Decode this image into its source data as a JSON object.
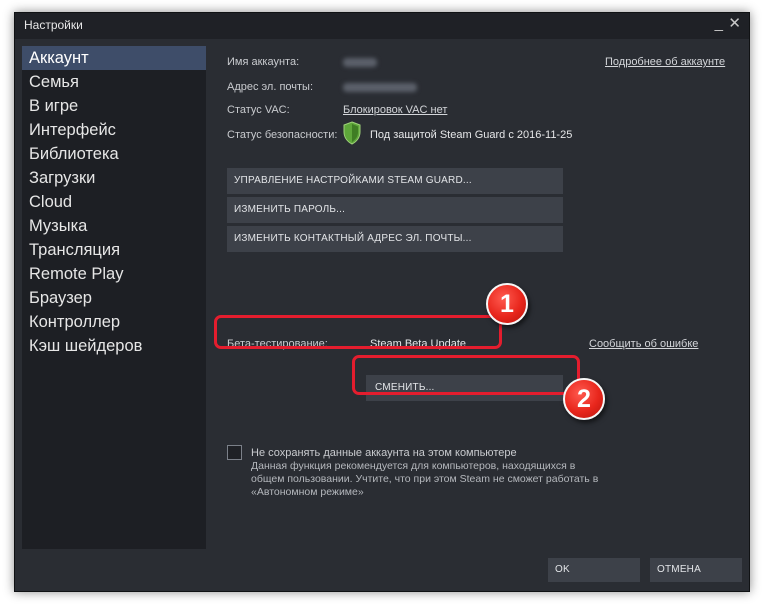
{
  "window": {
    "title": "Настройки",
    "minimize_glyph": "_",
    "close_glyph": "✕"
  },
  "sidebar": {
    "items": [
      {
        "label": "Аккаунт",
        "active": true
      },
      {
        "label": "Семья"
      },
      {
        "label": "В игре"
      },
      {
        "label": "Интерфейс"
      },
      {
        "label": "Библиотека"
      },
      {
        "label": "Загрузки"
      },
      {
        "label": "Cloud"
      },
      {
        "label": "Музыка"
      },
      {
        "label": "Трансляция"
      },
      {
        "label": "Remote Play"
      },
      {
        "label": "Браузер"
      },
      {
        "label": "Контроллер"
      },
      {
        "label": "Кэш шейдеров"
      }
    ]
  },
  "account": {
    "name_label": "Имя аккаунта:",
    "email_label": "Адрес эл. почты:",
    "vac_label": "Статус VAC:",
    "vac_value": "Блокировок VAC нет",
    "security_label": "Статус безопасности:",
    "security_value": "Под защитой Steam Guard с 2016-11-25",
    "details_link": "Подробнее об аккаунте",
    "shield_color": "#5ea63a"
  },
  "buttons": {
    "steam_guard": "УПРАВЛЕНИЕ НАСТРОЙКАМИ STEAM GUARD...",
    "change_password": "ИЗМЕНИТЬ ПАРОЛЬ...",
    "change_email": "ИЗМЕНИТЬ КОНТАКТНЫЙ АДРЕС ЭЛ. ПОЧТЫ...",
    "change_beta": "СМЕНИТЬ..."
  },
  "beta": {
    "label": "Бета-тестирование:",
    "value": "Steam Beta Update",
    "report_link": "Сообщить об ошибке"
  },
  "remember": {
    "checkbox_label": "Не сохранять данные аккаунта на этом компьютере",
    "checked": false,
    "note": "Данная функция рекомендуется для компьютеров, находящихся в общем пользовании. Учтите, что при этом Steam не сможет работать в «Автономном режиме»"
  },
  "footer": {
    "ok": "OK",
    "cancel": "ОТМЕНА"
  },
  "annotations": {
    "badge_1": "1",
    "badge_2": "2",
    "highlight_color": "#e41d2e"
  },
  "theme": {
    "window_bg": "#2a2d33",
    "sidebar_bg": "#1d1f24",
    "active_bg": "#3e4d69",
    "button_bg": "#3d4149"
  }
}
